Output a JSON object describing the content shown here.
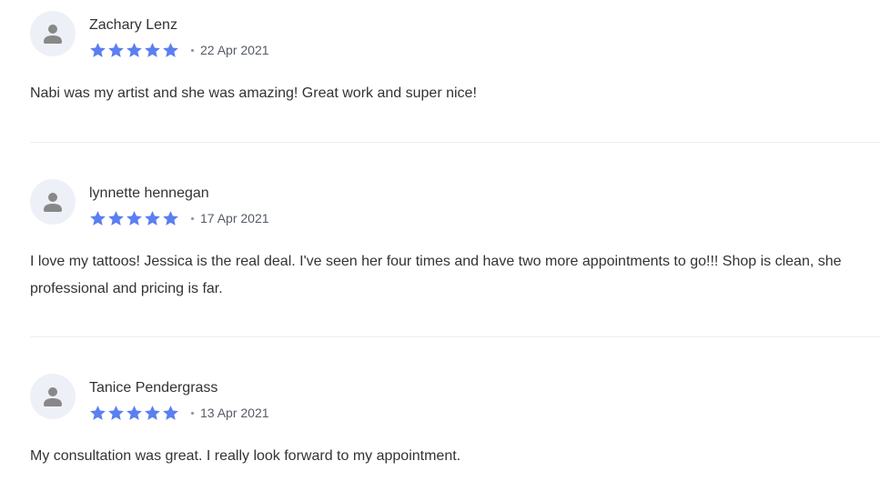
{
  "colors": {
    "star": "#5b7ff0",
    "avatar_bg": "#eef0f7",
    "avatar_icon": "#888888",
    "divider": "#eceef2"
  },
  "reviews": [
    {
      "author": "Zachary Lenz",
      "rating": 5,
      "rating_max": 5,
      "separator": "•",
      "date": "22 Apr 2021",
      "text": "Nabi was my artist and she was amazing! Great work and super nice!",
      "avatar_icon": "user-icon"
    },
    {
      "author": "lynnette hennegan",
      "rating": 5,
      "rating_max": 5,
      "separator": "•",
      "date": "17 Apr 2021",
      "text": "I love my tattoos! Jessica is the real deal. I've seen her four times and have two more appointments to go!!! Shop is clean, she professional and pricing is far.",
      "avatar_icon": "user-icon"
    },
    {
      "author": "Tanice Pendergrass",
      "rating": 5,
      "rating_max": 5,
      "separator": "•",
      "date": "13 Apr 2021",
      "text": "My consultation was great. I really look forward to my appointment.",
      "avatar_icon": "user-icon"
    }
  ]
}
